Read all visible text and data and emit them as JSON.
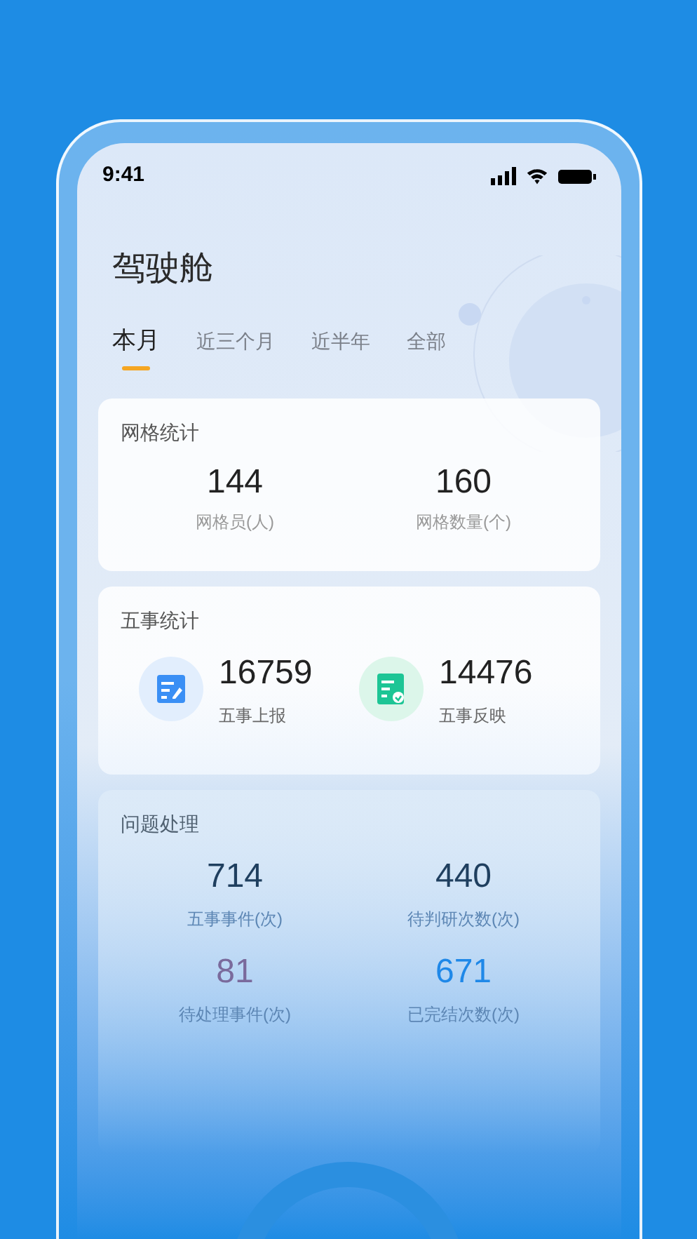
{
  "status_bar": {
    "time": "9:41"
  },
  "title": "驾驶舱",
  "tabs": [
    {
      "label": "本月",
      "selected": true
    },
    {
      "label": "近三个月",
      "selected": false
    },
    {
      "label": "近半年",
      "selected": false
    },
    {
      "label": "全部",
      "selected": false
    }
  ],
  "grid_stats": {
    "title": "网格统计",
    "items": [
      {
        "value": "144",
        "label": "网格员(人)"
      },
      {
        "value": "160",
        "label": "网格数量(个)"
      }
    ]
  },
  "five_stats": {
    "title": "五事统计",
    "items": [
      {
        "kind": "report",
        "value": "16759",
        "label": "五事上报"
      },
      {
        "kind": "feedback",
        "value": "14476",
        "label": "五事反映"
      }
    ]
  },
  "issues": {
    "title": "问题处理",
    "items": [
      {
        "value": "714",
        "label": "五事事件(次)",
        "color": "#1f3f5f"
      },
      {
        "value": "440",
        "label": "待判研次数(次)",
        "color": "#1f3f5f"
      },
      {
        "value": "81",
        "label": "待处理事件(次)",
        "color": "#7a6a9c"
      },
      {
        "value": "671",
        "label": "已完结次数(次)",
        "color": "#1f88e8"
      }
    ]
  }
}
